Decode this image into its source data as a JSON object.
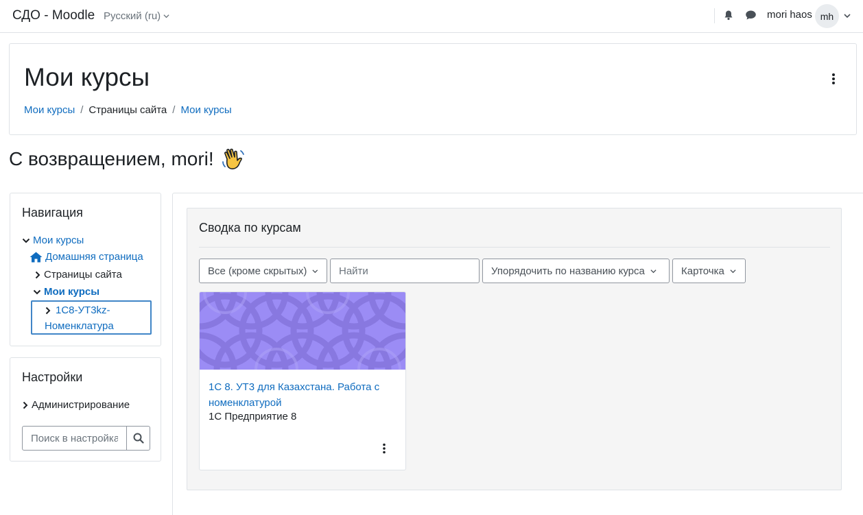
{
  "navbar": {
    "brand": "СДО - Moodle",
    "language": "Русский (ru)",
    "username": "mori haos",
    "avatar_initials": "mh",
    "icons": [
      "bell-icon",
      "chat-icon",
      "chevron-down-icon"
    ]
  },
  "header": {
    "title": "Мои курсы",
    "breadcrumb": [
      "Мои курсы",
      "Страницы сайта",
      "Мои курсы"
    ]
  },
  "welcome": {
    "text": "С возвращением, mori!",
    "icon": "waving-hand-icon"
  },
  "navigation": {
    "title": "Навигация",
    "items": [
      {
        "label": "Мои курсы"
      },
      {
        "label": "Домашняя страница",
        "icon": "home-icon"
      },
      {
        "label": "Страницы сайта"
      },
      {
        "label": "Мои курсы"
      },
      {
        "label_line1": "1С8-УТ3kz-",
        "label_line2": "Номенклатура"
      }
    ]
  },
  "settings": {
    "title": "Настройки",
    "admin_label": "Администрирование",
    "search_placeholder": "Поиск в настройках"
  },
  "overview": {
    "title": "Сводка по курсам",
    "filter_label": "Все (кроме скрытых)",
    "search_placeholder": "Найти",
    "sort_label": "Упорядочить по названию курса",
    "view_label": "Карточка",
    "courses": [
      {
        "name": "1С 8. УТ3 для Казахстана. Работа с номенклатурой",
        "category": "1С Предприятие 8"
      }
    ]
  },
  "colors": {
    "link": "#0f6cbf",
    "course_image": "#9b8cf5",
    "selected_border": "#4085c7"
  }
}
